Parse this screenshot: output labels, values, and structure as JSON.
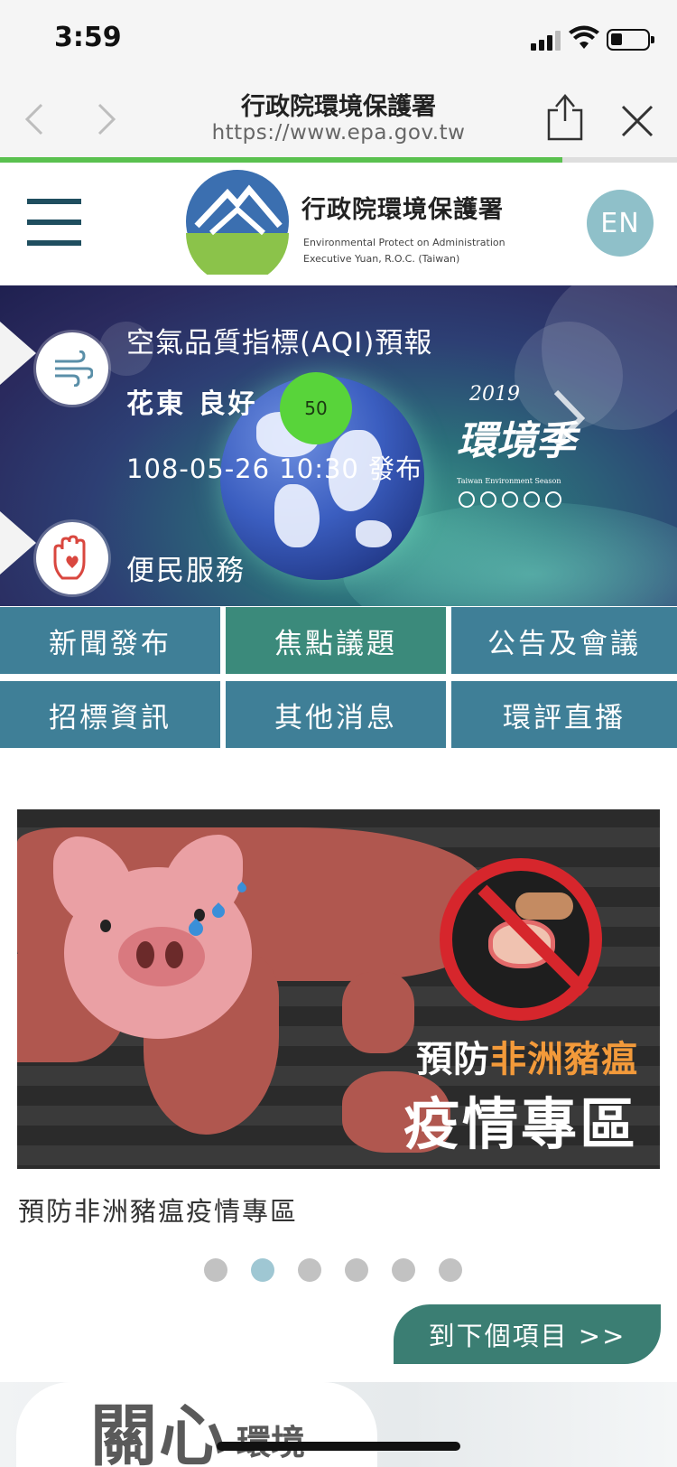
{
  "status_bar": {
    "time": "3:59"
  },
  "browser": {
    "title": "行政院環境保護署",
    "url": "https://www.epa.gov.tw",
    "load_progress_fraction": 0.83
  },
  "header": {
    "logo_cn": "行政院環境保護署",
    "logo_en_line1": "Environmental Protect on Administration",
    "logo_en_line2": "Executive Yuan, R.O.C. (Taiwan)",
    "lang_button": "EN"
  },
  "hero": {
    "aqi_title": "空氣品質指標(AQI)預報",
    "aqi_region": "花東 良好",
    "aqi_value": "50",
    "aqi_time": "108-05-26 10:30 發布",
    "service_label": "便民服務",
    "season_year": "2019",
    "season_script": "環境季",
    "season_en": "Taiwan Environment Season"
  },
  "categories": [
    {
      "label": "新聞發布"
    },
    {
      "label": "焦點議題"
    },
    {
      "label": "公告及會議"
    },
    {
      "label": "招標資訊"
    },
    {
      "label": "其他消息"
    },
    {
      "label": "環評直播"
    }
  ],
  "carousel": {
    "slide_line1_prefix": "預防",
    "slide_line1_accent": "非洲豬瘟",
    "slide_line2": "疫情專區",
    "caption": "預防非洲豬瘟疫情專區",
    "dot_count": 6,
    "active_dot": 2,
    "next_button": "到下個項目 >>"
  },
  "section": {
    "title_big": "關心",
    "title_small": "環境"
  },
  "colors": {
    "category_blue": "#3f7f97",
    "category_active": "#3b8a7b",
    "progress_green": "#5ac14f",
    "aqi_good": "#58d43a"
  }
}
